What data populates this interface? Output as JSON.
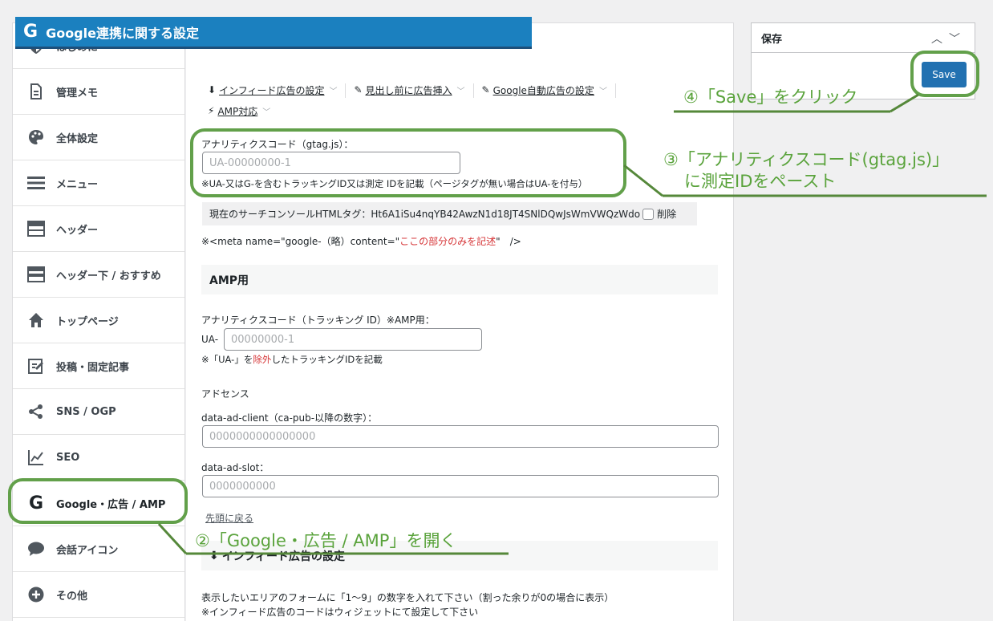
{
  "sidebar": {
    "items": [
      {
        "label": "はじめに",
        "icon": "shield-icon"
      },
      {
        "label": "管理メモ",
        "icon": "document-icon"
      },
      {
        "label": "全体設定",
        "icon": "palette-icon"
      },
      {
        "label": "メニュー",
        "icon": "menu-icon"
      },
      {
        "label": "ヘッダー",
        "icon": "header-icon"
      },
      {
        "label": "ヘッダー下 / おすすめ",
        "icon": "header-below-icon"
      },
      {
        "label": "トップページ",
        "icon": "home-icon"
      },
      {
        "label": "投稿・固定記事",
        "icon": "edit-icon"
      },
      {
        "label": "SNS / OGP",
        "icon": "share-icon"
      },
      {
        "label": "SEO",
        "icon": "chart-icon"
      },
      {
        "label": "Google・広告 / AMP",
        "icon": "google-icon"
      },
      {
        "label": "会話アイコン",
        "icon": "speech-bubble-icon"
      },
      {
        "label": "その他",
        "icon": "plus-circle-icon"
      }
    ]
  },
  "main": {
    "header_title": "Google連携に関する設定",
    "tabs": [
      {
        "label": "インフィード広告の設定",
        "icon": "circle-down-icon"
      },
      {
        "label": "見出し前に広告挿入",
        "icon": "wand-icon"
      },
      {
        "label": "Google自動広告の設定",
        "icon": "wand-icon"
      },
      {
        "label": "AMP対応",
        "icon": "bolt-icon"
      }
    ],
    "analytics_label": "アナリティクスコード（gtag.js）：",
    "analytics_placeholder": "UA-00000000-1",
    "analytics_note": "※UA-又はG-を含むトラッキングID又は測定 IDを記載（ページタグが無い場合はUA-を付与）",
    "search_console_label": "現在のサーチコンソールHTMLタグ：Ht6A1iSu4nqYB42AwzN1d18JT4SNlDQwJsWmVWQzWdo",
    "delete_label": "削除",
    "meta_note_prefix": "※<meta name=\"google-（略）content=\"",
    "meta_note_red": "ここの部分のみを記述",
    "meta_note_suffix": "\"　/>",
    "amp_section": "AMP用",
    "amp_analytics_label": "アナリティクスコード（トラッキング ID）※AMP用：",
    "amp_prefix": "UA-",
    "amp_placeholder": "00000000-1",
    "amp_note_prefix": "※「UA-」を",
    "amp_note_red": "除外",
    "amp_note_suffix": "したトラッキングIDを記載",
    "adsense_label": "アドセンス",
    "client_label": "data-ad-client（ca-pub-以降の数字）：",
    "client_placeholder": "0000000000000000",
    "slot_label": "data-ad-slot：",
    "slot_placeholder": "0000000000",
    "back_to_top": "先頭に戻る",
    "infeed_section": "インフィード広告の設定",
    "infeed_note1": "表示したいエリアのフォームに「1〜9」の数字を入れて下さい（割った余りが0の場合に表示）",
    "infeed_note2": "※インフィード広告のコードはウィジェットにて設定して下さい"
  },
  "savebox": {
    "title": "保存",
    "button": "Save"
  },
  "annotations": {
    "step2": "②「Google・広告 / AMP」を開く",
    "step3_line1": "③「アナリティクスコード(gtag.js)」",
    "step3_line2": "に測定IDをペースト",
    "step4": "④「Save」をクリック"
  },
  "colors": {
    "header_blue": "#1b80bf",
    "save_blue": "#2271b1",
    "annotation_green": "#5aa33c",
    "highlight_green": "#62a04a",
    "note_red": "#d63638"
  }
}
